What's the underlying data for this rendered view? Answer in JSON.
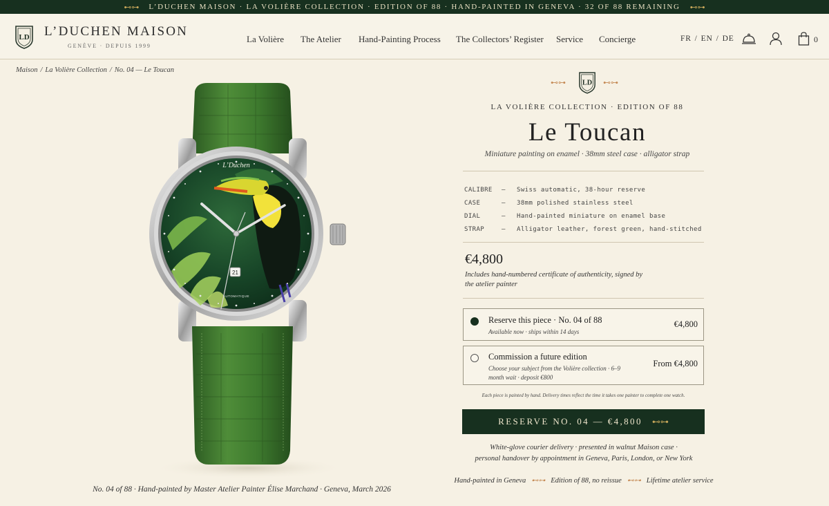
{
  "banner": {
    "text": "L’DUCHEN MAISON · LA VOLIÈRE COLLECTION · EDITION OF 88 · HAND-PAINTED IN GENEVA · 32 OF 88 REMAINING",
    "ornament": "⊷⊶"
  },
  "brand": {
    "name": "L’DUCHEN MAISON",
    "subtitle": "GENÈVE · DEPUIS 1999",
    "crest_letters": "LD"
  },
  "nav": [
    "La Volière",
    "The Atelier",
    "Hand-Painting Process",
    "The Collectors’ Register",
    "Service",
    "Concierge"
  ],
  "langs": [
    "FR",
    "EN",
    "DE"
  ],
  "header_icons": [
    "concierge-bell-icon",
    "account-icon",
    "shopping-bag-icon"
  ],
  "cart_count": "0",
  "breadcrumb": [
    "Maison",
    "La Volière Collection",
    "No. 04 — Le Toucan"
  ],
  "breadcrumb_sep": "/",
  "watch": {
    "dial_brand": "L’Duchen",
    "dial_bottom": "AUTOMATIQUE",
    "date": "21"
  },
  "caption": "No. 04 of 88  ·  Hand-painted by Master Atelier Painter Élise Marchand  ·  Geneva, March 2026",
  "product": {
    "collection": "LA VOLIÈRE COLLECTION · EDITION OF 88",
    "title": "Le Toucan",
    "subtitle": "Miniature painting on enamel  ·  38mm steel case  ·  alligator strap",
    "specs": [
      {
        "key": "CALIBRE",
        "dash": "—",
        "value": "Swiss automatic, 38-hour reserve"
      },
      {
        "key": "CASE",
        "dash": "—",
        "value": "38mm polished stainless steel"
      },
      {
        "key": "DIAL",
        "dash": "—",
        "value": "Hand-painted miniature on enamel base"
      },
      {
        "key": "STRAP",
        "dash": "—",
        "value": "Alligator leather, forest green, hand-stitched"
      }
    ],
    "price": "€4,800",
    "price_note": "Includes hand-numbered certificate of authenticity, signed by the atelier painter"
  },
  "options": [
    {
      "label": "Reserve this piece  ·  No. 04 of 88",
      "desc": "Available now · ships within 14 days",
      "price": "€4,800",
      "selected": true
    },
    {
      "label": "Commission a future edition",
      "desc": "Choose your subject from the Volière collection · 6–9 month wait · deposit €800",
      "price": "From €4,800",
      "selected": false
    }
  ],
  "tiny_note": "Each piece is painted by hand. Delivery times reflect the time it takes one painter to complete one watch.",
  "cta": "RESERVE NO. 04 — €4,800",
  "delivery": [
    "White-glove courier delivery  ·  presented in walnut Maison case  ·",
    "personal handover by appointment in Geneva, Paris, London, or New York"
  ],
  "assurances": [
    "Hand-painted in Geneva",
    "Edition of 88, no reissue",
    "Lifetime atelier service"
  ],
  "colors": {
    "forest": "#17301f",
    "cream": "#f6f1e4",
    "gold": "#c9a85a",
    "strap": "#3f7a2e"
  }
}
